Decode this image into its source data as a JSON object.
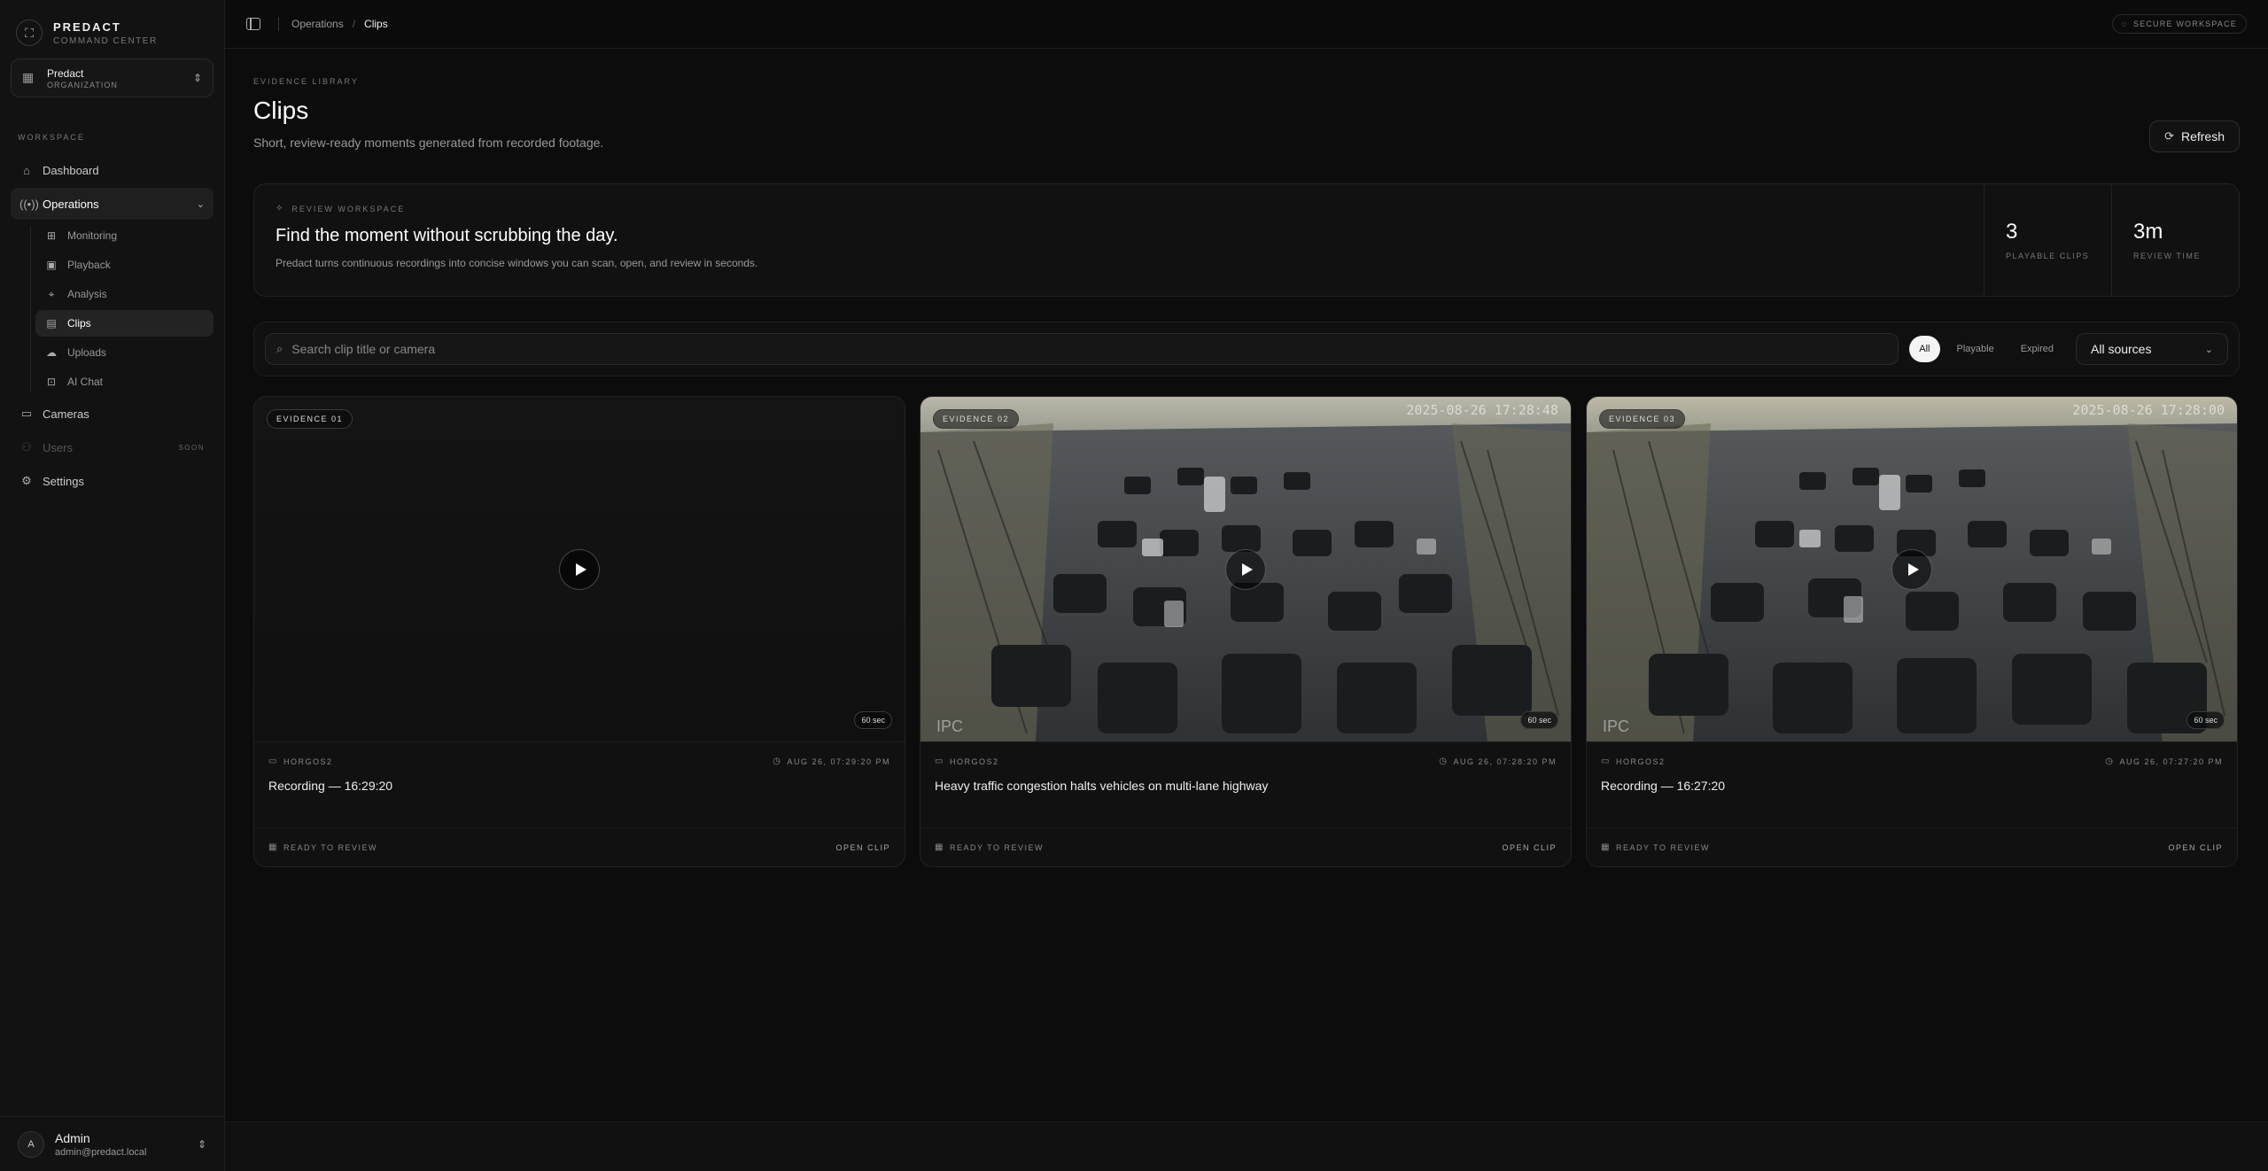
{
  "brand": {
    "name": "PREDACT",
    "subtitle": "COMMAND CENTER"
  },
  "org": {
    "name": "Predact",
    "type": "ORGANIZATION"
  },
  "sidebar": {
    "section_label": "WORKSPACE",
    "items": [
      {
        "label": "Dashboard",
        "icon": "home-icon"
      },
      {
        "label": "Operations",
        "icon": "radio-icon"
      },
      {
        "label": "Cameras",
        "icon": "video-icon"
      },
      {
        "label": "Users",
        "icon": "users-icon",
        "badge": "SOON"
      },
      {
        "label": "Settings",
        "icon": "gear-icon"
      }
    ],
    "sub_items": [
      {
        "label": "Monitoring",
        "icon": "grid-icon"
      },
      {
        "label": "Playback",
        "icon": "film-icon"
      },
      {
        "label": "Analysis",
        "icon": "scan-icon"
      },
      {
        "label": "Clips",
        "icon": "clip-icon"
      },
      {
        "label": "Uploads",
        "icon": "cloud-upload-icon"
      },
      {
        "label": "AI Chat",
        "icon": "bot-icon"
      }
    ]
  },
  "user": {
    "initial": "A",
    "name": "Admin",
    "email": "admin@predact.local"
  },
  "topbar": {
    "breadcrumb": [
      "Operations",
      "/",
      "Clips"
    ],
    "secure_label": "SECURE WORKSPACE"
  },
  "page": {
    "eyebrow": "EVIDENCE LIBRARY",
    "title": "Clips",
    "subtitle": "Short, review-ready moments generated from recorded footage.",
    "refresh_label": "Refresh"
  },
  "hero": {
    "eyebrow": "REVIEW WORKSPACE",
    "title": "Find the moment without scrubbing the day.",
    "description": "Predact turns continuous recordings into concise windows you can scan, open, and review in seconds.",
    "stats": [
      {
        "value": "3",
        "label": "PLAYABLE CLIPS"
      },
      {
        "value": "3m",
        "label": "REVIEW TIME"
      }
    ]
  },
  "filters": {
    "search_placeholder": "Search clip title or camera",
    "tabs": [
      "All",
      "Playable",
      "Expired"
    ],
    "active_tab": "All",
    "source_select": "All sources"
  },
  "clips": [
    {
      "tag": "EVIDENCE 01",
      "timestamp_overlay": "",
      "duration": "60 sec",
      "watermark": "",
      "camera": "HORGOS2",
      "time": "AUG 26, 07:29:20 PM",
      "title": "Recording — 16:29:20",
      "status": "READY TO REVIEW",
      "action": "OPEN CLIP"
    },
    {
      "tag": "EVIDENCE 02",
      "timestamp_overlay": "2025-08-26 17:28:48",
      "duration": "60 sec",
      "watermark": "IPC",
      "camera": "HORGOS2",
      "time": "AUG 26, 07:28:20 PM",
      "title": "Heavy traffic congestion halts vehicles on multi-lane highway",
      "status": "READY TO REVIEW",
      "action": "OPEN CLIP"
    },
    {
      "tag": "EVIDENCE 03",
      "timestamp_overlay": "2025-08-26 17:28:00",
      "duration": "60 sec",
      "watermark": "IPC",
      "camera": "HORGOS2",
      "time": "AUG 26, 07:27:20 PM",
      "title": "Recording — 16:27:20",
      "status": "READY TO REVIEW",
      "action": "OPEN CLIP"
    }
  ]
}
